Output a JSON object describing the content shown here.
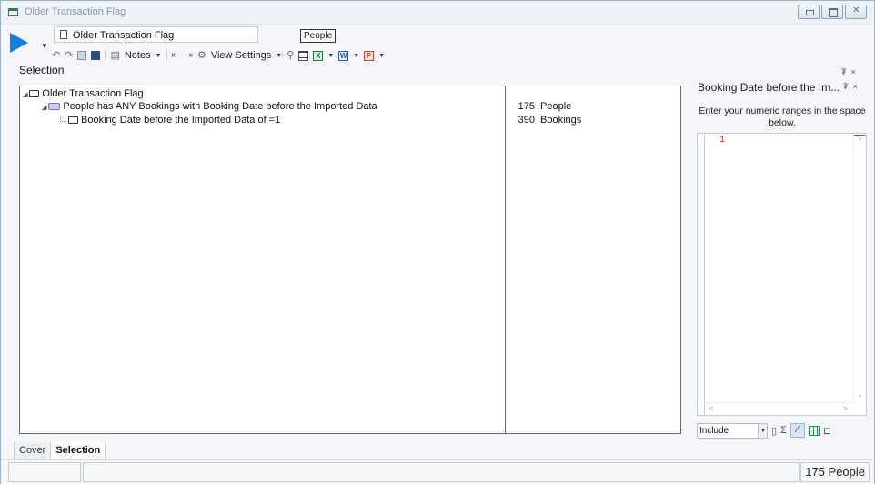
{
  "window": {
    "title": "Older Transaction Flag"
  },
  "header": {
    "selection_name": "Older Transaction Flag",
    "resolve_table": "People"
  },
  "toolbar": {
    "notes_label": "Notes",
    "view_settings_label": "View Settings"
  },
  "section": {
    "label": "Selection"
  },
  "tree": {
    "root_label": "Older Transaction Flag",
    "any_label": "People has ANY Bookings with Booking Date before the Imported Data",
    "leaf_label": "Booking Date before the Imported Data of =1"
  },
  "counts": [
    {
      "number": "175",
      "table": "People"
    },
    {
      "number": "390",
      "table": "Bookings"
    }
  ],
  "right_panel": {
    "title": "Booking Date before the Im...",
    "description": "Enter your numeric ranges in the space below.",
    "editor_line": "1",
    "mode_select": "Include"
  },
  "tabs": [
    {
      "label": "Cover"
    },
    {
      "label": "Selection"
    }
  ],
  "status": {
    "count_text": "175 People"
  },
  "icons": {
    "run": "play-icon",
    "undo": "undo-icon",
    "redo": "redo-icon",
    "save": "save-icon",
    "excel": "excel-icon",
    "word": "word-icon",
    "powerpoint": "powerpoint-icon"
  },
  "colors": {
    "run_blue": "#1a7be0",
    "any_badge": "#c9cdf7",
    "editor_line_number": "#c0392b"
  }
}
